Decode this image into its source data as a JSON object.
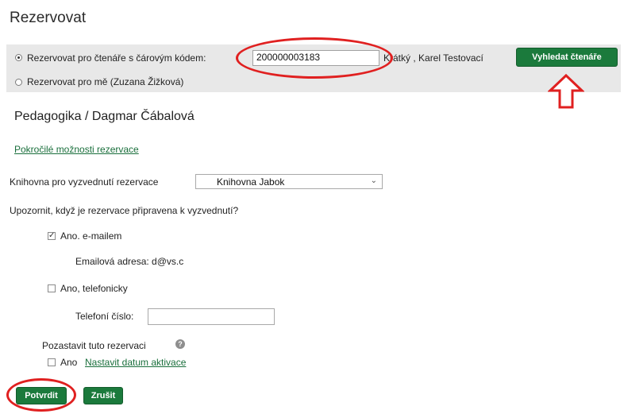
{
  "page": {
    "title": "Rezervovat"
  },
  "patron": {
    "option_barcode_label": "Rezervovat pro čtenáře s čárovým kódem:",
    "barcode_value": "200000003183",
    "patron_name": "Krátký , Karel Testovací",
    "find_button": "Vyhledat čtenáře",
    "option_self_label": "Rezervovat pro mě (Zuzana Žižková)"
  },
  "item": {
    "heading": "Pedagogika / Dagmar Čábalová"
  },
  "advanced_link": "Pokročilé možnosti rezervace",
  "pickup": {
    "label": "Knihovna pro vyzvednutí rezervace",
    "selected": "Knihovna Jabok"
  },
  "notify": {
    "question": "Upozornit, když je rezervace připravena k vyzvednutí?",
    "email_label": "Ano. e-mailem",
    "email_address_label": "Emailová adresa: d@vs.c",
    "phone_label": "Ano, telefonicky",
    "phone_field_label": "Telefoní číslo:"
  },
  "suspend": {
    "label": "Pozastavit tuto rezervaci",
    "checkbox_label": "Ano",
    "link": "Nastavit datum aktivace"
  },
  "actions": {
    "confirm": "Potvrdit",
    "cancel": "Zrušit"
  },
  "colors": {
    "button_green": "#1b7a3c",
    "highlight_red": "#e02020"
  }
}
